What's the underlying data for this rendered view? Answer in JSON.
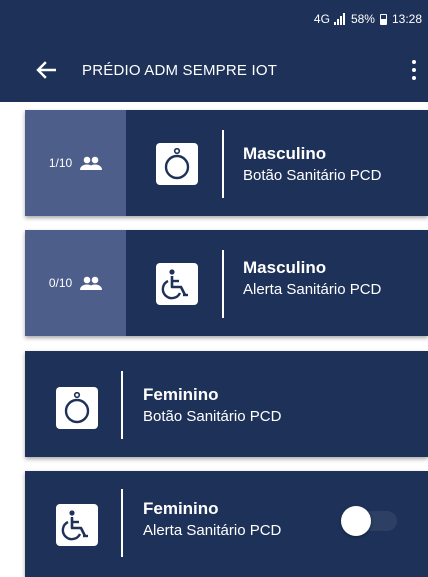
{
  "status_bar": {
    "network": "4G",
    "battery": "58%",
    "time": "13:28"
  },
  "app_bar": {
    "title": "PRÉDIO ADM SEMPRE IOT",
    "back_icon": "arrow-left-icon",
    "menu_icon": "more-vertical-icon"
  },
  "colors": {
    "primary": "#1e3259",
    "counter_panel": "#4e5e8a"
  },
  "devices": [
    {
      "counter": "1/10",
      "counter_icon": "people-icon",
      "device_icon": "push-button-icon",
      "title": "Masculino",
      "subtitle": "Botão Sanitário PCD"
    },
    {
      "counter": "0/10",
      "counter_icon": "people-icon",
      "device_icon": "wheelchair-icon",
      "title": "Masculino",
      "subtitle": "Alerta Sanitário PCD"
    },
    {
      "device_icon": "push-button-icon",
      "title": "Feminino",
      "subtitle": "Botão Sanitário PCD"
    },
    {
      "device_icon": "wheelchair-icon",
      "title": "Feminino",
      "subtitle": "Alerta Sanitário PCD",
      "toggle_on": false
    }
  ]
}
